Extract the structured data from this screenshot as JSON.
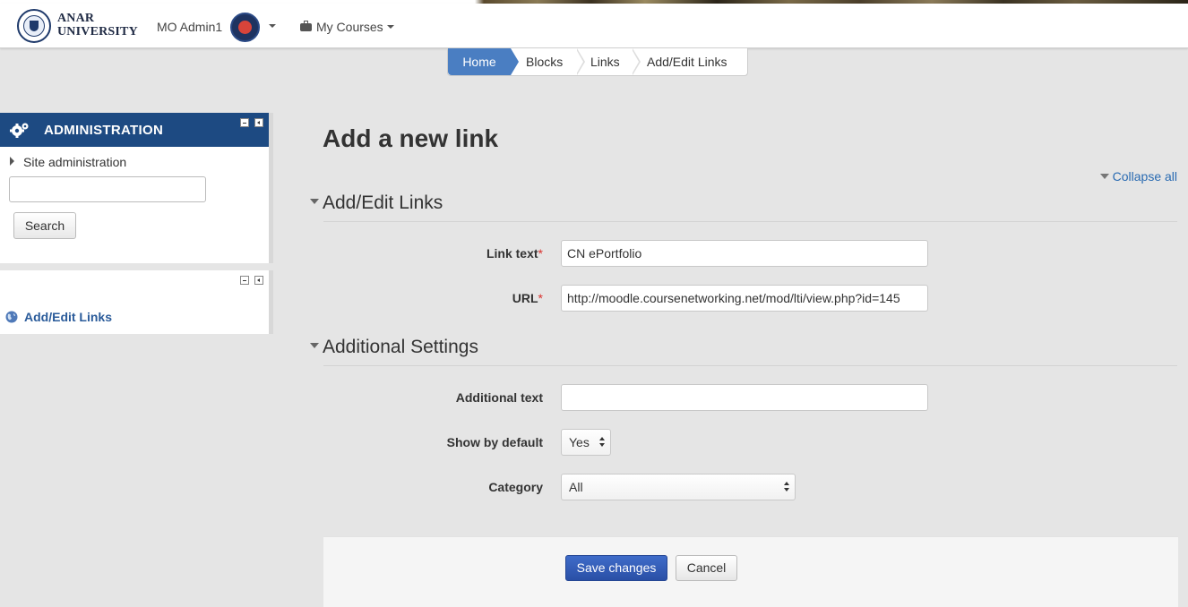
{
  "header": {
    "logo_line1": "ANAR",
    "logo_line2": "UNIVERSITY",
    "user_name": "MO Admin1",
    "courses_menu": "My Courses"
  },
  "breadcrumb": [
    "Home",
    "Blocks",
    "Links",
    "Add/Edit Links"
  ],
  "admin_block": {
    "title": "ADMINISTRATION",
    "site_admin_label": "Site administration",
    "search_value": "",
    "search_button": "Search"
  },
  "links_block": {
    "link_label": "Add/Edit Links"
  },
  "main": {
    "heading": "Add a new link",
    "collapse_all": "Collapse all",
    "section1_title": "Add/Edit Links",
    "section2_title": "Additional Settings",
    "fields": {
      "link_text_label": "Link text",
      "link_text_value": "CN ePortfolio",
      "url_label": "URL",
      "url_value": "http://moodle.coursenetworking.net/mod/lti/view.php?id=145",
      "additional_text_label": "Additional text",
      "additional_text_value": "",
      "show_by_default_label": "Show by default",
      "show_by_default_value": "Yes",
      "category_label": "Category",
      "category_value": "All"
    },
    "required_mark": "*",
    "save_button": "Save changes",
    "cancel_button": "Cancel"
  },
  "colors": {
    "admin_header": "#1d4a82",
    "breadcrumb_home": "#4a7ec2",
    "primary_button": "#2a4fa6",
    "link": "#2a6bb2",
    "required": "#d9302c"
  }
}
